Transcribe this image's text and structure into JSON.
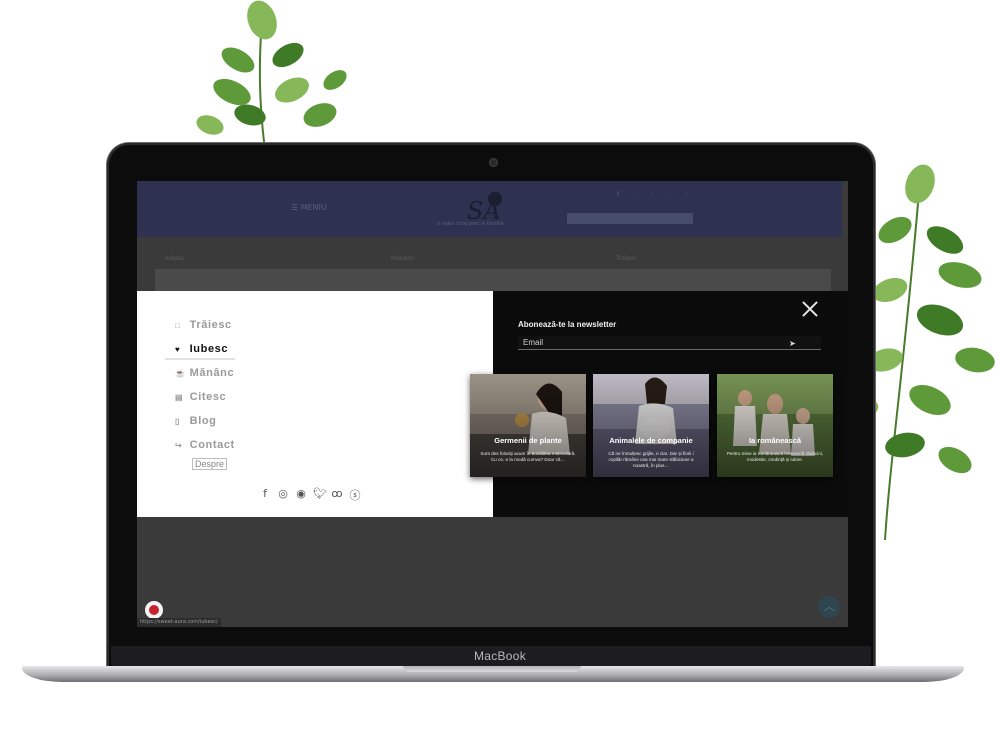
{
  "device": {
    "brand": "MacBook"
  },
  "site": {
    "menu_label": "MENIU",
    "tagline": "o viata intre parc si familie",
    "columns": [
      "Iubesc",
      "Mananc",
      "Traiesc"
    ],
    "social_icons": [
      "facebook-icon",
      "twitter-icon",
      "instagram-icon",
      "youtube-icon",
      "email-icon"
    ]
  },
  "menu": {
    "items": [
      {
        "label": "Trăiesc",
        "icon": "□"
      },
      {
        "label": "Iubesc",
        "icon": "♥",
        "active": true
      },
      {
        "label": "Mănânc",
        "icon": "☕"
      },
      {
        "label": "Citesc",
        "icon": "▤"
      },
      {
        "label": "Blog",
        "icon": "▯"
      },
      {
        "label": "Contact",
        "icon": "↪"
      }
    ],
    "despre": "Despre",
    "social": [
      "facebook-icon",
      "whatsapp-icon",
      "telegram-icon",
      "twitter-icon",
      "odnoklassniki-icon",
      "skype-icon"
    ]
  },
  "newsletter": {
    "title": "Abonează-te la newsletter",
    "placeholder": "Email"
  },
  "cards": [
    {
      "title": "Germenii de plante",
      "excerpt": "Sunt des folosiți acum în bucătăria moleculară. Cu ce, e la modă cumva? Doar că…"
    },
    {
      "title": "Animalele de companie",
      "excerpt": "Că ne înmulțesc grijile, e clar. Dar și fiorii i copilăr rămâne cea mai mare slăbiciune a noastră, în plus…"
    },
    {
      "title": "Ia românească",
      "excerpt": "Pentru mine ia românească înseamnă rădăcini, modestie, credință și iubire."
    }
  ],
  "status_url": "https://sweet-aura.com/iubesc/",
  "colors": {
    "header": "#2e3250",
    "overlay": "#0b0b0b",
    "panel": "#ffffff"
  }
}
